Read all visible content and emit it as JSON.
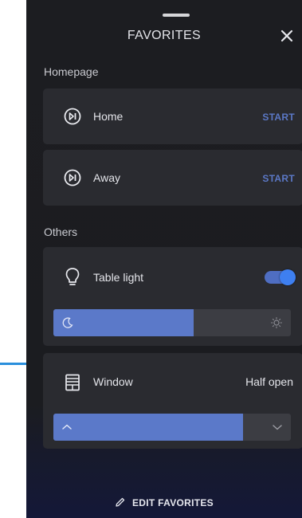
{
  "header": {
    "title": "FAVORITES"
  },
  "sections": {
    "homepage": "Homepage",
    "others": "Others"
  },
  "homepage": [
    {
      "label": "Home",
      "action": "START"
    },
    {
      "label": "Away",
      "action": "START"
    }
  ],
  "table_light": {
    "label": "Table light",
    "on": true,
    "brightness_fraction": 0.59
  },
  "window": {
    "label": "Window",
    "status": "Half open",
    "open_fraction": 0.8
  },
  "footer": {
    "edit_label": "EDIT FAVORITES"
  },
  "colors": {
    "accent": "#5b79c9",
    "start_text": "#5b78c6",
    "toggle_knob": "#3e7ff0",
    "connector": "#2a8fdc"
  },
  "icons": [
    "close-icon",
    "play-pause-icon",
    "lightbulb-icon",
    "moon-icon",
    "sun-icon",
    "window-blinds-icon",
    "chevron-up-icon",
    "chevron-down-icon",
    "pencil-icon"
  ]
}
